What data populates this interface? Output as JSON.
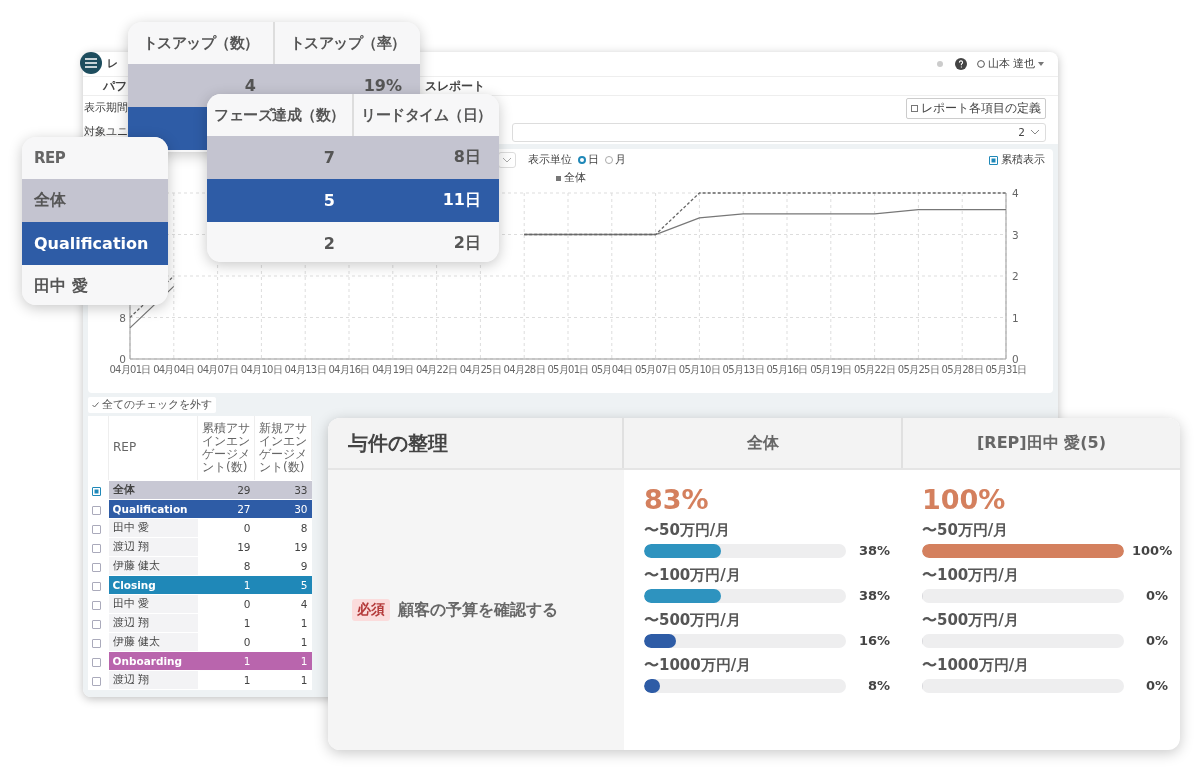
{
  "app": {
    "title": "レ",
    "user": "山本 達也",
    "tabs": [
      {
        "label": "パフ"
      },
      {
        "label": "スレポート"
      }
    ],
    "filters": [
      {
        "label": "表示期間"
      },
      {
        "label": "対象ユニ",
        "value": "2"
      }
    ],
    "definition_button": "レポート各項目の定義"
  },
  "chart_panel": {
    "unit_label": "表示単位",
    "units": [
      {
        "label": "日",
        "selected": true
      },
      {
        "label": "月",
        "selected": false
      }
    ],
    "cumulative": {
      "label": "累積表示",
      "checked": true
    },
    "left_axis_labels": [
      "8",
      "0"
    ],
    "chart_data": {
      "type": "line",
      "categories": [
        "04月01日",
        "04月04日",
        "04月07日",
        "04月10日",
        "04月13日",
        "04月16日",
        "04月19日",
        "04月22日",
        "04月25日",
        "04月28日",
        "05月01日",
        "05月04日",
        "05月07日",
        "05月10日",
        "05月13日",
        "05月16日",
        "05月19日",
        "05月22日",
        "05月25日",
        "05月28日",
        "05月31日"
      ],
      "series": [
        {
          "name": "全体",
          "color": "#777777",
          "line_style": "solid",
          "values": [
            0.75,
            1.75,
            null,
            null,
            null,
            null,
            null,
            null,
            null,
            3,
            3,
            3,
            3,
            3.4,
            3.5,
            3.5,
            3.5,
            3.5,
            3.6,
            3.6,
            3.6
          ]
        },
        {
          "color": "#666666",
          "line_style": "dashed",
          "values": [
            1,
            2,
            null,
            null,
            null,
            null,
            null,
            null,
            null,
            3,
            3,
            3,
            3,
            4,
            4,
            4,
            4,
            4,
            4,
            4,
            4
          ]
        }
      ],
      "ylim": [
        0,
        4
      ],
      "yticks": [
        0,
        1,
        2,
        3,
        4
      ],
      "grid": true
    }
  },
  "table": {
    "uncheck_all": "全てのチェックを外す",
    "columns": [
      "REP",
      "累積アサインエンゲージメント(数)",
      "新規アサインエンゲージメント(数)"
    ],
    "rows": [
      {
        "kind": "group",
        "name": "全体",
        "color": "#c8c8d4",
        "checked": true,
        "values": [
          "29",
          "33"
        ]
      },
      {
        "kind": "group",
        "name": "Qualification",
        "color": "#2e5ca6",
        "checked": false,
        "values": [
          "27",
          "30"
        ]
      },
      {
        "kind": "member",
        "name": "田中 愛",
        "checked": false,
        "values": [
          "0",
          "8"
        ]
      },
      {
        "kind": "member",
        "name": "渡辺 翔",
        "checked": false,
        "values": [
          "19",
          "19"
        ]
      },
      {
        "kind": "member",
        "name": "伊藤 健太",
        "checked": false,
        "values": [
          "8",
          "9"
        ]
      },
      {
        "kind": "group",
        "name": "Closing",
        "color": "#1f88b8",
        "checked": false,
        "values": [
          "1",
          "5"
        ]
      },
      {
        "kind": "member",
        "name": "田中 愛",
        "checked": false,
        "values": [
          "0",
          "4"
        ]
      },
      {
        "kind": "member",
        "name": "渡辺 翔",
        "checked": false,
        "values": [
          "1",
          "1"
        ]
      },
      {
        "kind": "member",
        "name": "伊藤 健太",
        "checked": false,
        "values": [
          "0",
          "1"
        ]
      },
      {
        "kind": "group",
        "name": "Onboarding",
        "color": "#b965ad",
        "checked": false,
        "values": [
          "1",
          "1"
        ]
      },
      {
        "kind": "member",
        "name": "渡辺 翔",
        "checked": false,
        "values": [
          "1",
          "1"
        ]
      }
    ]
  },
  "tossup_card": {
    "columns": [
      "トスアップ（数）",
      "トスアップ（率）"
    ],
    "rows": [
      {
        "color": "#c4c4d0",
        "values": [
          "4",
          "19%"
        ]
      },
      {
        "color": "#2e5ca6",
        "values": []
      }
    ]
  },
  "phase_card": {
    "columns": [
      "フェーズ達成（数）",
      "リードタイム（日）"
    ],
    "rows": [
      {
        "color": "#c4c4d0",
        "values": [
          "7",
          "8日"
        ]
      },
      {
        "color": "#2e5ca6",
        "values": [
          "5",
          "11日"
        ]
      },
      {
        "color": "#f7f7f8",
        "values": [
          "2",
          "2日"
        ]
      }
    ]
  },
  "rep_card": {
    "header": "REP",
    "rows": [
      {
        "color": "#c4c4d0",
        "name": "全体"
      },
      {
        "color": "#2e5ca6",
        "name": "Qualification"
      },
      {
        "color": "#f7f7f8",
        "name": "田中 愛"
      }
    ]
  },
  "requirement_card": {
    "title": "与件の整理",
    "columns": [
      "全体",
      "[REP]田中 愛(5)"
    ],
    "tag": "必須",
    "task": "顧客の予算を確認する",
    "results": [
      {
        "total": "83%",
        "color": "#d4805e",
        "bars": [
          {
            "label": "〜50万円/月",
            "level": 0.38,
            "reading": "38%",
            "color": "#2e93bf"
          },
          {
            "label": "〜100万円/月",
            "level": 0.38,
            "reading": "38%",
            "color": "#2e93bf"
          },
          {
            "label": "〜500万円/月",
            "level": 0.16,
            "reading": "16%",
            "color": "#2e5ca6"
          },
          {
            "label": "〜1000万円/月",
            "level": 0.08,
            "reading": "8%",
            "color": "#2e5ca6"
          }
        ]
      },
      {
        "total": "100%",
        "color": "#d4805e",
        "bars": [
          {
            "label": "〜50万円/月",
            "level": 1,
            "reading": "100%",
            "color": "#d4805e"
          },
          {
            "label": "〜100万円/月",
            "level": 0,
            "reading": "0%"
          },
          {
            "label": "〜500万円/月",
            "level": 0,
            "reading": "0%"
          },
          {
            "label": "〜1000万円/月",
            "level": 0,
            "reading": "0%"
          }
        ]
      }
    ]
  }
}
